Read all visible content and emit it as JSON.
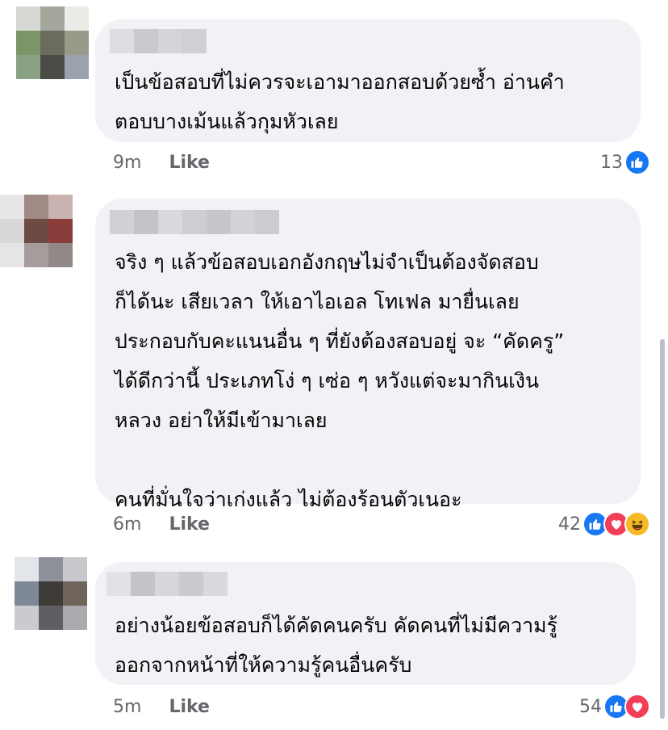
{
  "comments": [
    {
      "text": "เป็นข้อสอบที่ไม่ควรจะเอามาออกสอบด้วยซ้ำ อ่านคำ\nตอบบางเม้นแล้วกุมหัวเลย",
      "time": "9m",
      "like_label": "Like",
      "reaction_count": "13",
      "reactions": [
        "like-icon"
      ]
    },
    {
      "text": "จริง ๆ แล้วข้อสอบเอกอังกฤษไม่จำเป็นต้องจัดสอบ\nก็ได้นะ เสียเวลา ให้เอาไอเอล โทเฟล มายื่นเลย\nประกอบกับคะแนนอื่น ๆ ที่ยังต้องสอบอยู่ จะ “คัดครู”\nได้ดีกว่านี้ ประเภทโง่ ๆ เซ่อ ๆ หวังแต่จะมากินเงิน\nหลวง อย่าให้มีเข้ามาเลย\n\nคนที่มั่นใจว่าเก่งแล้ว ไม่ต้องร้อนตัวเนอะ",
      "time": "6m",
      "like_label": "Like",
      "reaction_count": "42",
      "reactions": [
        "like-icon",
        "love-icon",
        "haha-icon"
      ]
    },
    {
      "text": "อย่างน้อยข้อสอบก็ได้คัดคนครับ คัดคนที่ไม่มีความรู้\nออกจากหน้าที่ให้ความรู้คนอื่นครับ",
      "time": "5m",
      "like_label": "Like",
      "reaction_count": "54",
      "reactions": [
        "like-icon",
        "love-icon"
      ]
    }
  ],
  "colors": {
    "bubble": "#f0f2f5",
    "meta_text": "#65676b",
    "like_reaction": "#1877f2",
    "love_reaction": "#f33e58",
    "haha_reaction": "#f7b928"
  }
}
